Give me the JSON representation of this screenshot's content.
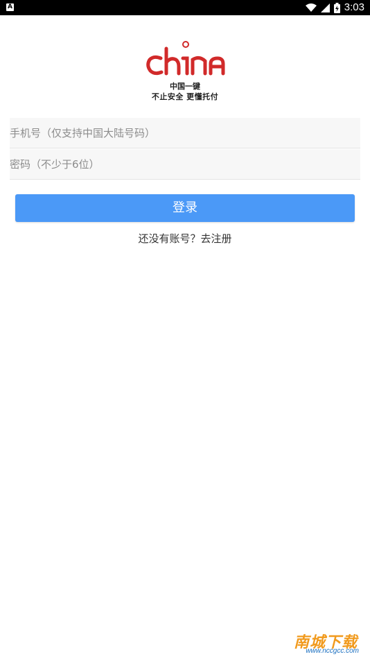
{
  "status_bar": {
    "time": "3:03",
    "left_icon_letter": "A",
    "icons": [
      "notification-a-icon",
      "wifi-icon",
      "signal-icon",
      "battery-charging-icon"
    ]
  },
  "logo": {
    "wordmark": "china",
    "line1": "中国一键",
    "line2": "不止安全  更懂托付",
    "brand_color": "#d12a2a"
  },
  "form": {
    "phone_placeholder": "手机号（仅支持中国大陆号码）",
    "phone_value": "",
    "password_placeholder": "密码（不少于6位）",
    "password_value": "",
    "login_label": "登录",
    "register_text": "还没有账号？去注册"
  },
  "watermark": {
    "title": "南城下载",
    "url": "www.nccgcc.com"
  },
  "colors": {
    "accent": "#4b99f7",
    "status_bar": "#000000",
    "logo_red": "#d12a2a",
    "watermark_orange": "#f19a1d"
  }
}
